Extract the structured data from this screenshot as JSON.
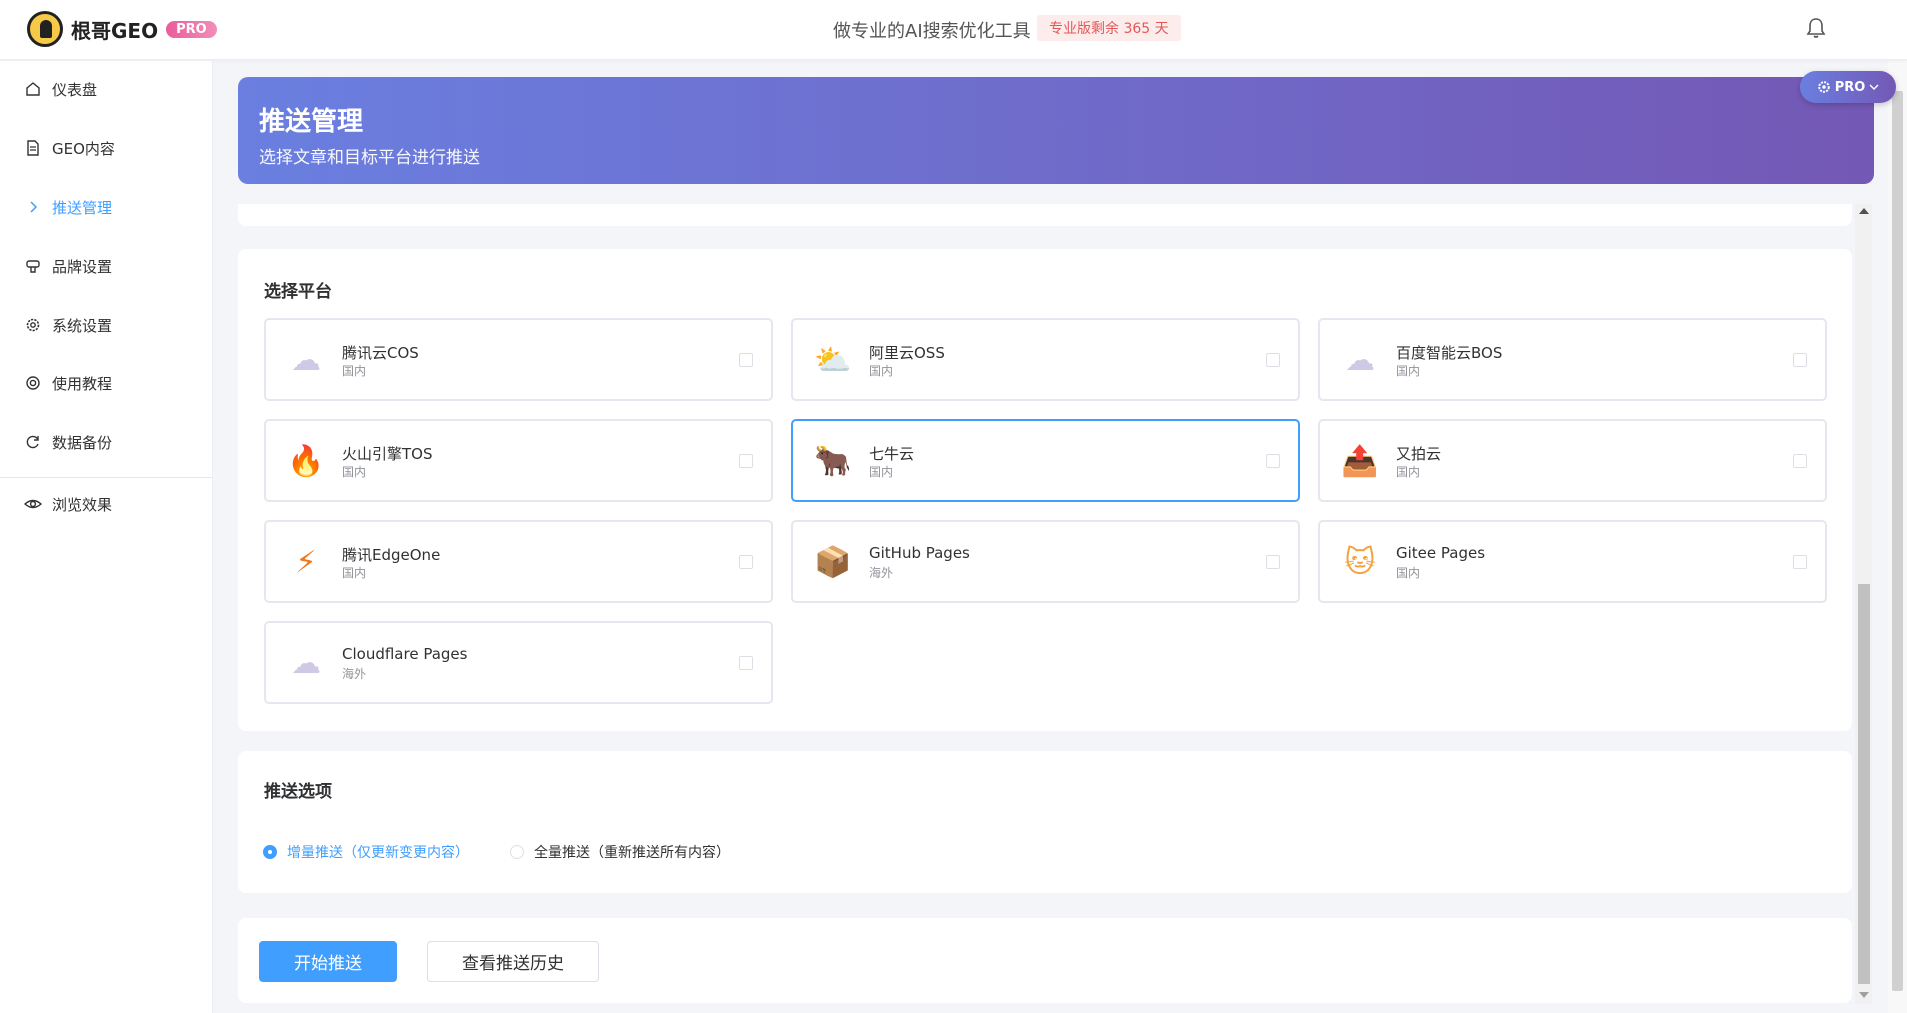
{
  "app": {
    "name": "根哥GEO",
    "badge": "PRO",
    "slogan": "做专业的AI搜索优化工具",
    "days_tag": "专业版剩余 365 天"
  },
  "sidebar": {
    "items": [
      {
        "label": "仪表盘",
        "icon": "home-icon"
      },
      {
        "label": "GEO内容",
        "icon": "document-icon"
      },
      {
        "label": "推送管理",
        "icon": "chevron-right-icon"
      },
      {
        "label": "品牌设置",
        "icon": "brand-icon"
      },
      {
        "label": "系统设置",
        "icon": "gear-icon"
      },
      {
        "label": "使用教程",
        "icon": "help-ring-icon"
      },
      {
        "label": "数据备份",
        "icon": "refresh-icon"
      },
      {
        "label": "浏览效果",
        "icon": "eye-icon"
      }
    ]
  },
  "banner": {
    "title": "推送管理",
    "subtitle": "选择文章和目标平台进行推送"
  },
  "pro_float": {
    "label": "PRO"
  },
  "platforms": {
    "title": "选择平台",
    "items": [
      {
        "name": "腾讯云COS",
        "region": "国内",
        "icon": "cloud-icon",
        "glyph": "☁",
        "selected": false
      },
      {
        "name": "阿里云OSS",
        "region": "国内",
        "icon": "sun-cloud-icon",
        "glyph": "⛅",
        "selected": false
      },
      {
        "name": "百度智能云BOS",
        "region": "国内",
        "icon": "cloud-icon",
        "glyph": "☁",
        "selected": false
      },
      {
        "name": "火山引擎TOS",
        "region": "国内",
        "icon": "fire-icon",
        "glyph": "🔥",
        "selected": false
      },
      {
        "name": "七牛云",
        "region": "国内",
        "icon": "ox-icon",
        "glyph": "🐂",
        "selected": true
      },
      {
        "name": "又拍云",
        "region": "国内",
        "icon": "upload-tray-icon",
        "glyph": "📤",
        "selected": false
      },
      {
        "name": "腾讯EdgeOne",
        "region": "国内",
        "icon": "lightning-icon",
        "glyph": "⚡",
        "selected": false
      },
      {
        "name": "GitHub Pages",
        "region": "海外",
        "icon": "package-icon",
        "glyph": "📦",
        "selected": false
      },
      {
        "name": "Gitee Pages",
        "region": "国内",
        "icon": "cat-icon",
        "glyph": "🐱",
        "selected": false
      },
      {
        "name": "Cloudflare Pages",
        "region": "海外",
        "icon": "cloud-icon",
        "glyph": "☁",
        "selected": false
      }
    ]
  },
  "options": {
    "title": "推送选项",
    "incremental": "增量推送（仅更新变更内容）",
    "full": "全量推送（重新推送所有内容）"
  },
  "actions": {
    "start": "开始推送",
    "history": "查看推送历史"
  }
}
